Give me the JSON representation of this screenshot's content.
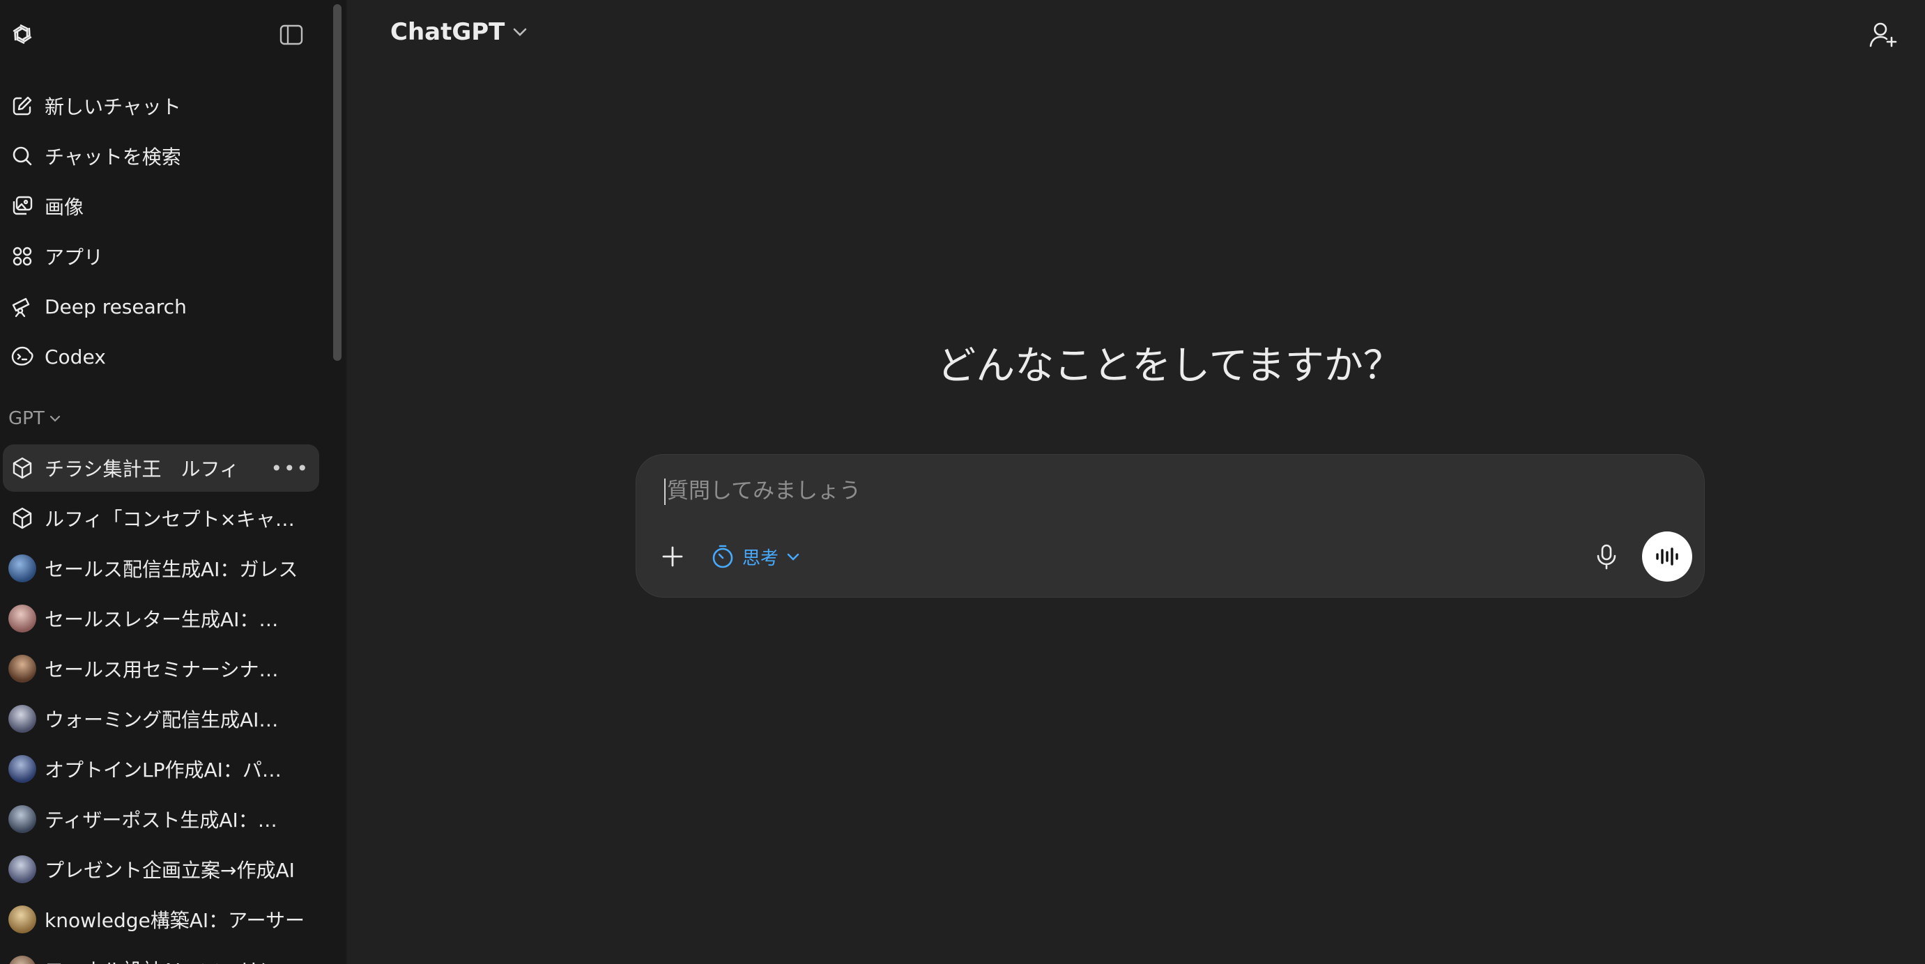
{
  "header": {
    "model_name": "ChatGPT"
  },
  "sidebar": {
    "nav_items": [
      {
        "icon": "edit-icon",
        "label": "新しいチャット"
      },
      {
        "icon": "search-icon",
        "label": "チャットを検索"
      },
      {
        "icon": "images-icon",
        "label": "画像"
      },
      {
        "icon": "apps-icon",
        "label": "アプリ"
      },
      {
        "icon": "telescope-icon",
        "label": "Deep research"
      },
      {
        "icon": "codex-icon",
        "label": "Codex"
      }
    ],
    "section_label": "GPT",
    "gpts": [
      {
        "label": "チラシ集計王　ルフィ",
        "icon": "cube-icon",
        "active": true
      },
      {
        "label": "ルフィ「コンセプト×キャラクター作成」",
        "icon": "cube-icon"
      },
      {
        "label": "セールス配信生成AI：ガレス",
        "icon": "avatar"
      },
      {
        "label": "セールスレター生成AI：モードレッド",
        "icon": "avatar"
      },
      {
        "label": "セールス用セミナーシナリオ",
        "icon": "avatar"
      },
      {
        "label": "ウォーミング配信生成AI：ランスロット",
        "icon": "avatar"
      },
      {
        "label": "オプトインLP作成AI：パーシヴァル",
        "icon": "avatar"
      },
      {
        "label": "ティザーポスト生成AI：ガウェイン",
        "icon": "avatar"
      },
      {
        "label": "プレゼント企画立案→作成AI",
        "icon": "avatar"
      },
      {
        "label": "knowledge構築AI：アーサー",
        "icon": "avatar"
      },
      {
        "label": "ファネル設計AI：マーリン",
        "icon": "avatar"
      }
    ]
  },
  "main": {
    "headline": "どんなことをしてますか？",
    "composer": {
      "placeholder": "質問してみましょう",
      "think_label": "思考"
    }
  },
  "colors": {
    "background": "#212121",
    "sidebar": "#181818",
    "composer": "#303030",
    "accent": "#48aaff"
  }
}
